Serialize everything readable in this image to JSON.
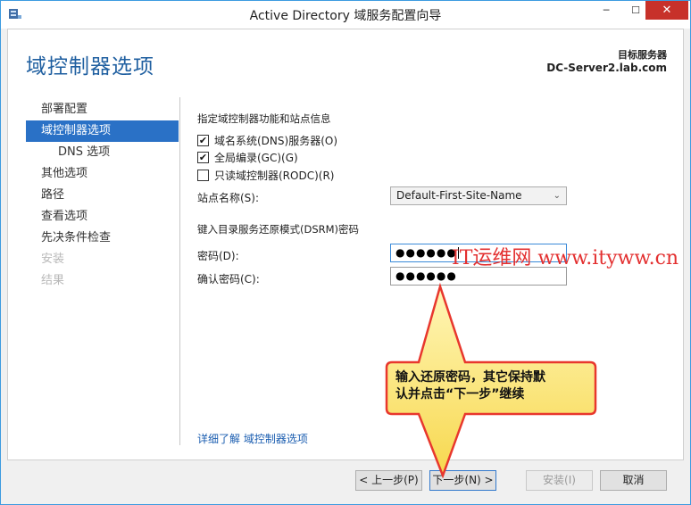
{
  "window": {
    "title": "Active Directory 域服务配置向导"
  },
  "header": {
    "page_title": "域控制器选项",
    "target_label": "目标服务器",
    "target_name": "DC-Server2.lab.com"
  },
  "nav": {
    "items": [
      {
        "label": "部署配置",
        "state": "normal"
      },
      {
        "label": "域控制器选项",
        "state": "active"
      },
      {
        "label": "DNS 选项",
        "state": "sub"
      },
      {
        "label": "其他选项",
        "state": "normal"
      },
      {
        "label": "路径",
        "state": "normal"
      },
      {
        "label": "查看选项",
        "state": "normal"
      },
      {
        "label": "先决条件检查",
        "state": "normal"
      },
      {
        "label": "安装",
        "state": "disabled"
      },
      {
        "label": "结果",
        "state": "disabled"
      }
    ]
  },
  "main": {
    "section1_label": "指定域控制器功能和站点信息",
    "checkboxes": [
      {
        "label": "域名系统(DNS)服务器(O)",
        "checked": true,
        "mark": "✔"
      },
      {
        "label": "全局编录(GC)(G)",
        "checked": true,
        "mark": "✔"
      },
      {
        "label": "只读域控制器(RODC)(R)",
        "checked": false,
        "mark": ""
      }
    ],
    "site_label": "站点名称(S):",
    "site_value": "Default-First-Site-Name",
    "section2_label": "键入目录服务还原模式(DSRM)密码",
    "password_label": "密码(D):",
    "password_value": "●●●●●●",
    "confirm_label": "确认密码(C):",
    "confirm_value": "●●●●●●",
    "more_link": "详细了解 域控制器选项"
  },
  "watermark": "IT运维网 www.ityww.cn",
  "callout": {
    "line1": "输入还原密码，其它保持默",
    "line2": "认并点击“下一步”继续"
  },
  "buttons": {
    "prev": "< 上一步(P)",
    "next": "下一步(N) >",
    "install": "安装(I)",
    "cancel": "取消"
  },
  "colors": {
    "accent": "#2a71c6",
    "title": "#1f5fa0",
    "callout_border": "#e8372d",
    "callout_fill": "#fde98a"
  }
}
